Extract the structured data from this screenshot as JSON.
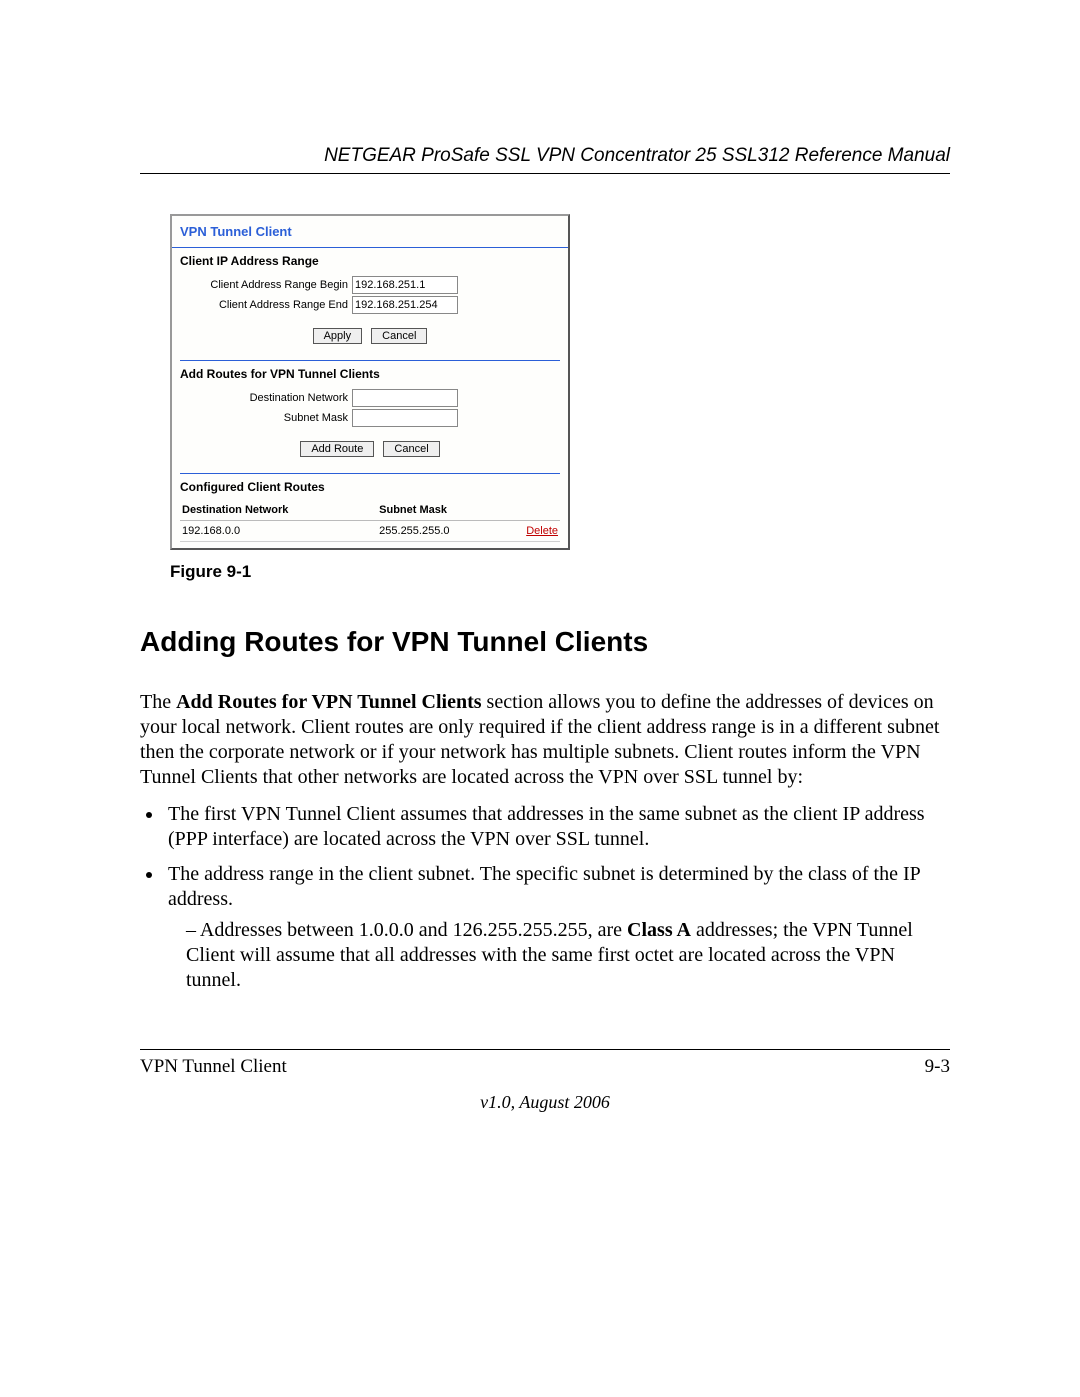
{
  "header": {
    "title": "NETGEAR ProSafe SSL VPN Concentrator 25 SSL312 Reference Manual"
  },
  "ui": {
    "title": "VPN Tunnel Client",
    "range_section": "Client IP Address Range",
    "range_begin_label": "Client Address Range Begin",
    "range_begin_value": "192.168.251.1",
    "range_end_label": "Client Address Range End",
    "range_end_value": "192.168.251.254",
    "apply_label": "Apply",
    "cancel_label": "Cancel",
    "add_routes_section": "Add Routes for VPN Tunnel Clients",
    "dest_net_label": "Destination Network",
    "subnet_label": "Subnet Mask",
    "add_route_label": "Add Route",
    "configured_section": "Configured Client Routes",
    "table": {
      "col_dest": "Destination Network",
      "col_mask": "Subnet Mask",
      "row0_dest": "192.168.0.0",
      "row0_mask": "255.255.255.0",
      "delete_label": "Delete"
    }
  },
  "figure_caption": "Figure 9-1",
  "section_heading": "Adding Routes for VPN Tunnel Clients",
  "para1_a": "The ",
  "para1_bold": "Add Routes for VPN Tunnel Clients",
  "para1_b": " section allows you to define the addresses of devices on your local network. Client routes are only required if the client address range is in a different subnet then the corporate network or if your network has multiple subnets. Client routes inform the VPN Tunnel Clients that other networks are located across the VPN over SSL tunnel by:",
  "bullet1": "The first VPN Tunnel Client assumes that addresses in the same subnet as the client IP address (PPP interface) are located across the VPN over SSL tunnel.",
  "bullet2": "The address range in the client subnet. The specific subnet is determined by the class of the IP address.",
  "sub1_a": "Addresses between 1.0.0.0 and 126.255.255.255, are ",
  "sub1_bold": "Class A",
  "sub1_b": " addresses; the VPN Tunnel Client will assume that all addresses with the same first octet are located across the VPN tunnel.",
  "footer": {
    "left": "VPN Tunnel Client",
    "right": "9-3",
    "version": "v1.0, August 2006"
  }
}
